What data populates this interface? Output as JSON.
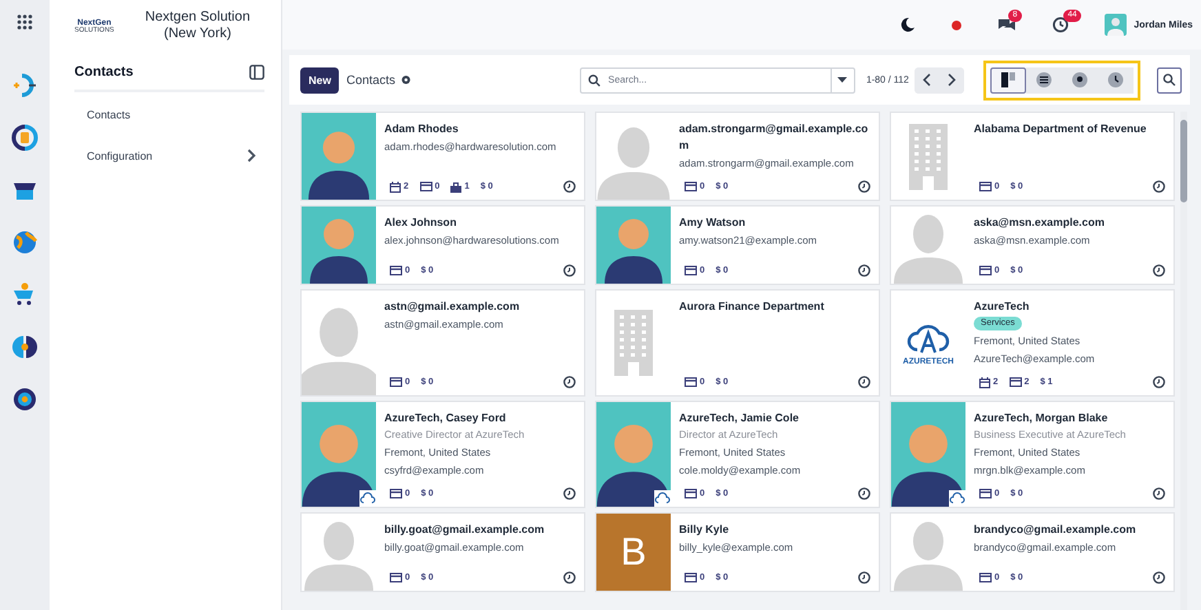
{
  "app_rail": {
    "items": [
      {
        "kind": "plus-minus"
      },
      {
        "kind": "dollar-sync"
      },
      {
        "kind": "store"
      },
      {
        "kind": "globe"
      },
      {
        "kind": "cart"
      },
      {
        "kind": "leaf"
      },
      {
        "kind": "gear"
      }
    ]
  },
  "company": {
    "logo_text": "NextGen",
    "logo_subtext": "SOLUTIONS",
    "name": "Nextgen Solution (New York)"
  },
  "sidebar": {
    "title": "Contacts",
    "items": [
      {
        "label": "Contacts",
        "has_submenu": false
      },
      {
        "label": "Configuration",
        "has_submenu": true
      }
    ]
  },
  "topbar": {
    "chat_badge": "8",
    "activity_badge": "44",
    "user": "Jordan Miles"
  },
  "control_panel": {
    "new_button": "New",
    "title": "Contacts",
    "search": {
      "placeholder": "Search..."
    },
    "pager": "1-80 / 112",
    "highlighted": true,
    "views": [
      {
        "kind": "kanban",
        "selected": true
      },
      {
        "kind": "list",
        "selected": false
      },
      {
        "kind": "map",
        "selected": false
      },
      {
        "kind": "activity",
        "selected": false
      }
    ]
  },
  "cards": [
    {
      "name": "Adam Rhodes",
      "email": "adam.rhodes@hardwaresolution.com",
      "photo": {
        "kind": "illustration"
      },
      "stats": [
        {
          "kind": "meetings",
          "value": "2"
        },
        {
          "kind": "invoices",
          "value": "0"
        },
        {
          "kind": "opportunities",
          "value": "1"
        },
        {
          "kind": "sales",
          "value": "$ 0"
        }
      ]
    },
    {
      "name": "adam.strongarm@gmail.example.com",
      "email": "adam.strongarm@gmail.example.com",
      "photo": {
        "kind": "placeholder"
      },
      "stats": [
        {
          "kind": "invoices",
          "value": "0"
        },
        {
          "kind": "sales",
          "value": "$ 0"
        }
      ]
    },
    {
      "name": "Alabama Department of Revenue",
      "photo": {
        "kind": "building"
      },
      "stats": [
        {
          "kind": "invoices",
          "value": "0"
        },
        {
          "kind": "sales",
          "value": "$ 0"
        }
      ]
    },
    {
      "name": "Alex Johnson",
      "email": "alex.johnson@hardwaresolutions.com",
      "photo": {
        "kind": "illustration"
      },
      "stats": [
        {
          "kind": "invoices",
          "value": "0"
        },
        {
          "kind": "sales",
          "value": "$ 0"
        }
      ]
    },
    {
      "name": "Amy Watson",
      "email": "amy.watson21@example.com",
      "photo": {
        "kind": "illustration"
      },
      "stats": [
        {
          "kind": "invoices",
          "value": "0"
        },
        {
          "kind": "sales",
          "value": "$ 0"
        }
      ]
    },
    {
      "name": "aska@msn.example.com",
      "email": "aska@msn.example.com",
      "photo": {
        "kind": "placeholder"
      },
      "stats": [
        {
          "kind": "invoices",
          "value": "0"
        },
        {
          "kind": "sales",
          "value": "$ 0"
        }
      ]
    },
    {
      "name": "astn@gmail.example.com",
      "email": "astn@gmail.example.com",
      "photo": {
        "kind": "placeholder"
      },
      "stats": [
        {
          "kind": "invoices",
          "value": "0"
        },
        {
          "kind": "sales",
          "value": "$ 0"
        }
      ]
    },
    {
      "name": "Aurora Finance Department",
      "photo": {
        "kind": "building"
      },
      "stats": [
        {
          "kind": "invoices",
          "value": "0"
        },
        {
          "kind": "sales",
          "value": "$ 0"
        }
      ]
    },
    {
      "name": "AzureTech",
      "tag": "Services",
      "location": "Fremont, United States",
      "email": "AzureTech@example.com",
      "photo": {
        "kind": "logo",
        "text": "AZURETECH"
      },
      "stats": [
        {
          "kind": "meetings",
          "value": "2"
        },
        {
          "kind": "invoices",
          "value": "2"
        },
        {
          "kind": "sales",
          "value": "$ 1"
        }
      ]
    },
    {
      "name": "AzureTech, Casey Ford",
      "job": "Creative Director at AzureTech",
      "location": "Fremont, United States",
      "email": "csyfrd@example.com",
      "photo": {
        "kind": "illustration"
      },
      "company_badge": true,
      "stats": [
        {
          "kind": "invoices",
          "value": "0"
        },
        {
          "kind": "sales",
          "value": "$ 0"
        }
      ]
    },
    {
      "name": "AzureTech, Jamie Cole",
      "job": "Director at AzureTech",
      "location": "Fremont, United States",
      "email": "cole.moldy@example.com",
      "photo": {
        "kind": "illustration"
      },
      "company_badge": true,
      "stats": [
        {
          "kind": "invoices",
          "value": "0"
        },
        {
          "kind": "sales",
          "value": "$ 0"
        }
      ]
    },
    {
      "name": "AzureTech, Morgan Blake",
      "job": "Business Executive at AzureTech",
      "location": "Fremont, United States",
      "email": "mrgn.blk@example.com",
      "photo": {
        "kind": "illustration"
      },
      "company_badge": true,
      "stats": [
        {
          "kind": "invoices",
          "value": "0"
        },
        {
          "kind": "sales",
          "value": "$ 0"
        }
      ]
    },
    {
      "name": "billy.goat@gmail.example.com",
      "email": "billy.goat@gmail.example.com",
      "photo": {
        "kind": "placeholder"
      },
      "stats": [
        {
          "kind": "invoices",
          "value": "0"
        },
        {
          "kind": "sales",
          "value": "$ 0"
        }
      ]
    },
    {
      "name": "Billy Kyle",
      "email": "billy_kyle@example.com",
      "photo": {
        "kind": "letter",
        "text": "B",
        "color": "#b8752c"
      },
      "stats": [
        {
          "kind": "invoices",
          "value": "0"
        },
        {
          "kind": "sales",
          "value": "$ 0"
        }
      ]
    },
    {
      "name": "brandyco@gmail.example.com",
      "email": "brandyco@gmail.example.com",
      "photo": {
        "kind": "placeholder"
      },
      "stats": [
        {
          "kind": "invoices",
          "value": "0"
        },
        {
          "kind": "sales",
          "value": "$ 0"
        }
      ]
    }
  ]
}
